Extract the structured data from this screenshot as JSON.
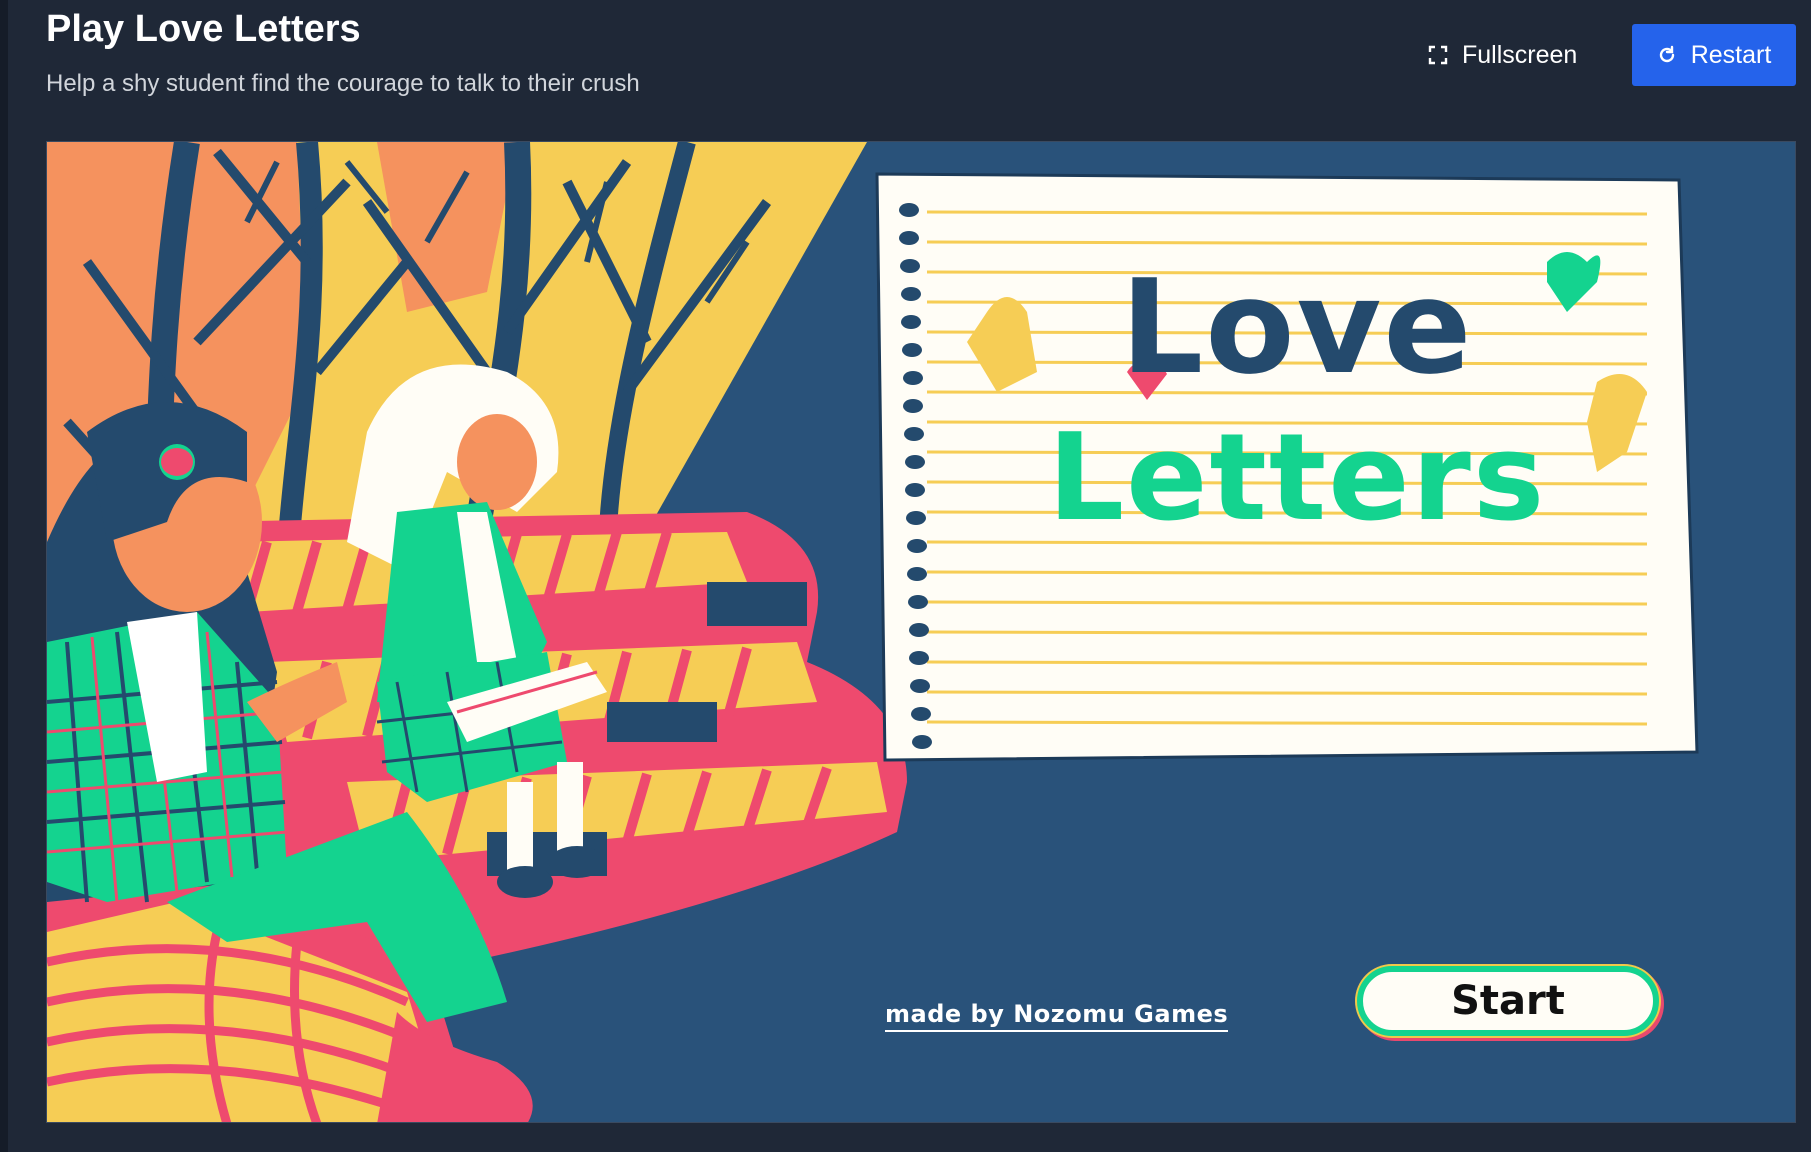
{
  "header": {
    "title": "Play Love Letters",
    "subtitle": "Help a shy student find the courage to talk to their crush",
    "fullscreen_label": "Fullscreen",
    "restart_label": "Restart"
  },
  "icons": {
    "fullscreen": "fullscreen-icon",
    "restart": "restart-icon"
  },
  "game": {
    "logo_line1": "Love",
    "logo_line2": "Letters",
    "credit": "made by Nozomu Games",
    "start_label": "Start"
  },
  "colors": {
    "page_background": "#1f2837",
    "restart_button": "#2563eb",
    "game_background": "#29527a",
    "pink": "#ee4a6e",
    "green": "#14d38f",
    "yellow": "#f6cd55",
    "navy": "#244a6d"
  }
}
